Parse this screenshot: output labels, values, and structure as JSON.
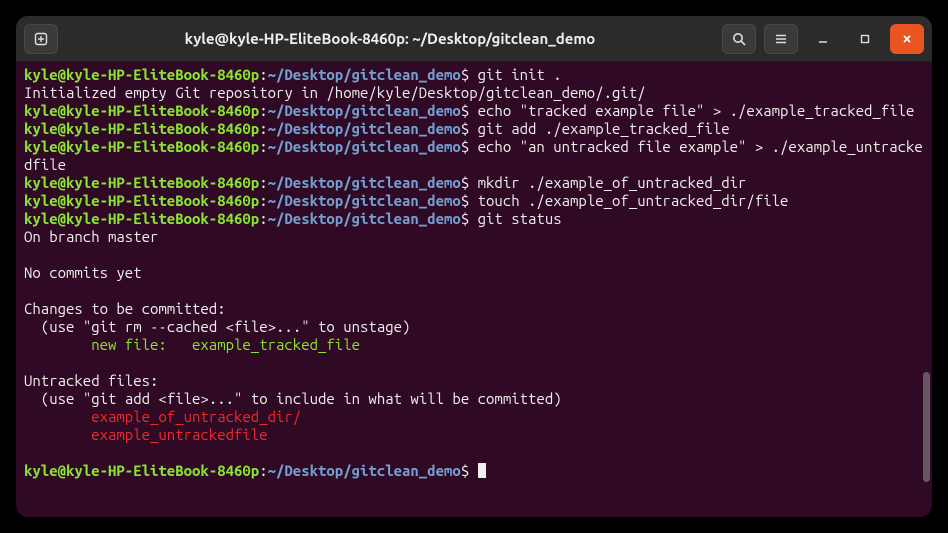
{
  "titlebar": {
    "title": "kyle@kyle-HP-EliteBook-8460p: ~/Desktop/gitclean_demo"
  },
  "prompt": {
    "user": "kyle@kyle-HP-EliteBook-8460p",
    "sep1": ":",
    "path": "~/Desktop/gitclean_demo",
    "sigil": "$"
  },
  "lines": {
    "cmd1": "git init .",
    "out1": "Initialized empty Git repository in /home/kyle/Desktop/gitclean_demo/.git/",
    "cmd2": "echo \"tracked example file\" > ./example_tracked_file",
    "cmd3": "git add ./example_tracked_file",
    "cmd4": "echo \"an untracked file example\" > ./example_untrackedfile",
    "cmd5": "mkdir ./example_of_untracked_dir",
    "cmd6": "touch ./example_of_untracked_dir/file",
    "cmd7": "git status",
    "status_branch": "On branch master",
    "status_nocommits": "No commits yet",
    "status_changes_header": "Changes to be committed:",
    "status_changes_hint": "  (use \"git rm --cached <file>...\" to unstage)",
    "status_staged_file": "        new file:   example_tracked_file",
    "status_untracked_header": "Untracked files:",
    "status_untracked_hint": "  (use \"git add <file>...\" to include in what will be committed)",
    "status_untracked_1": "        example_of_untracked_dir/",
    "status_untracked_2": "        example_untrackedfile"
  }
}
